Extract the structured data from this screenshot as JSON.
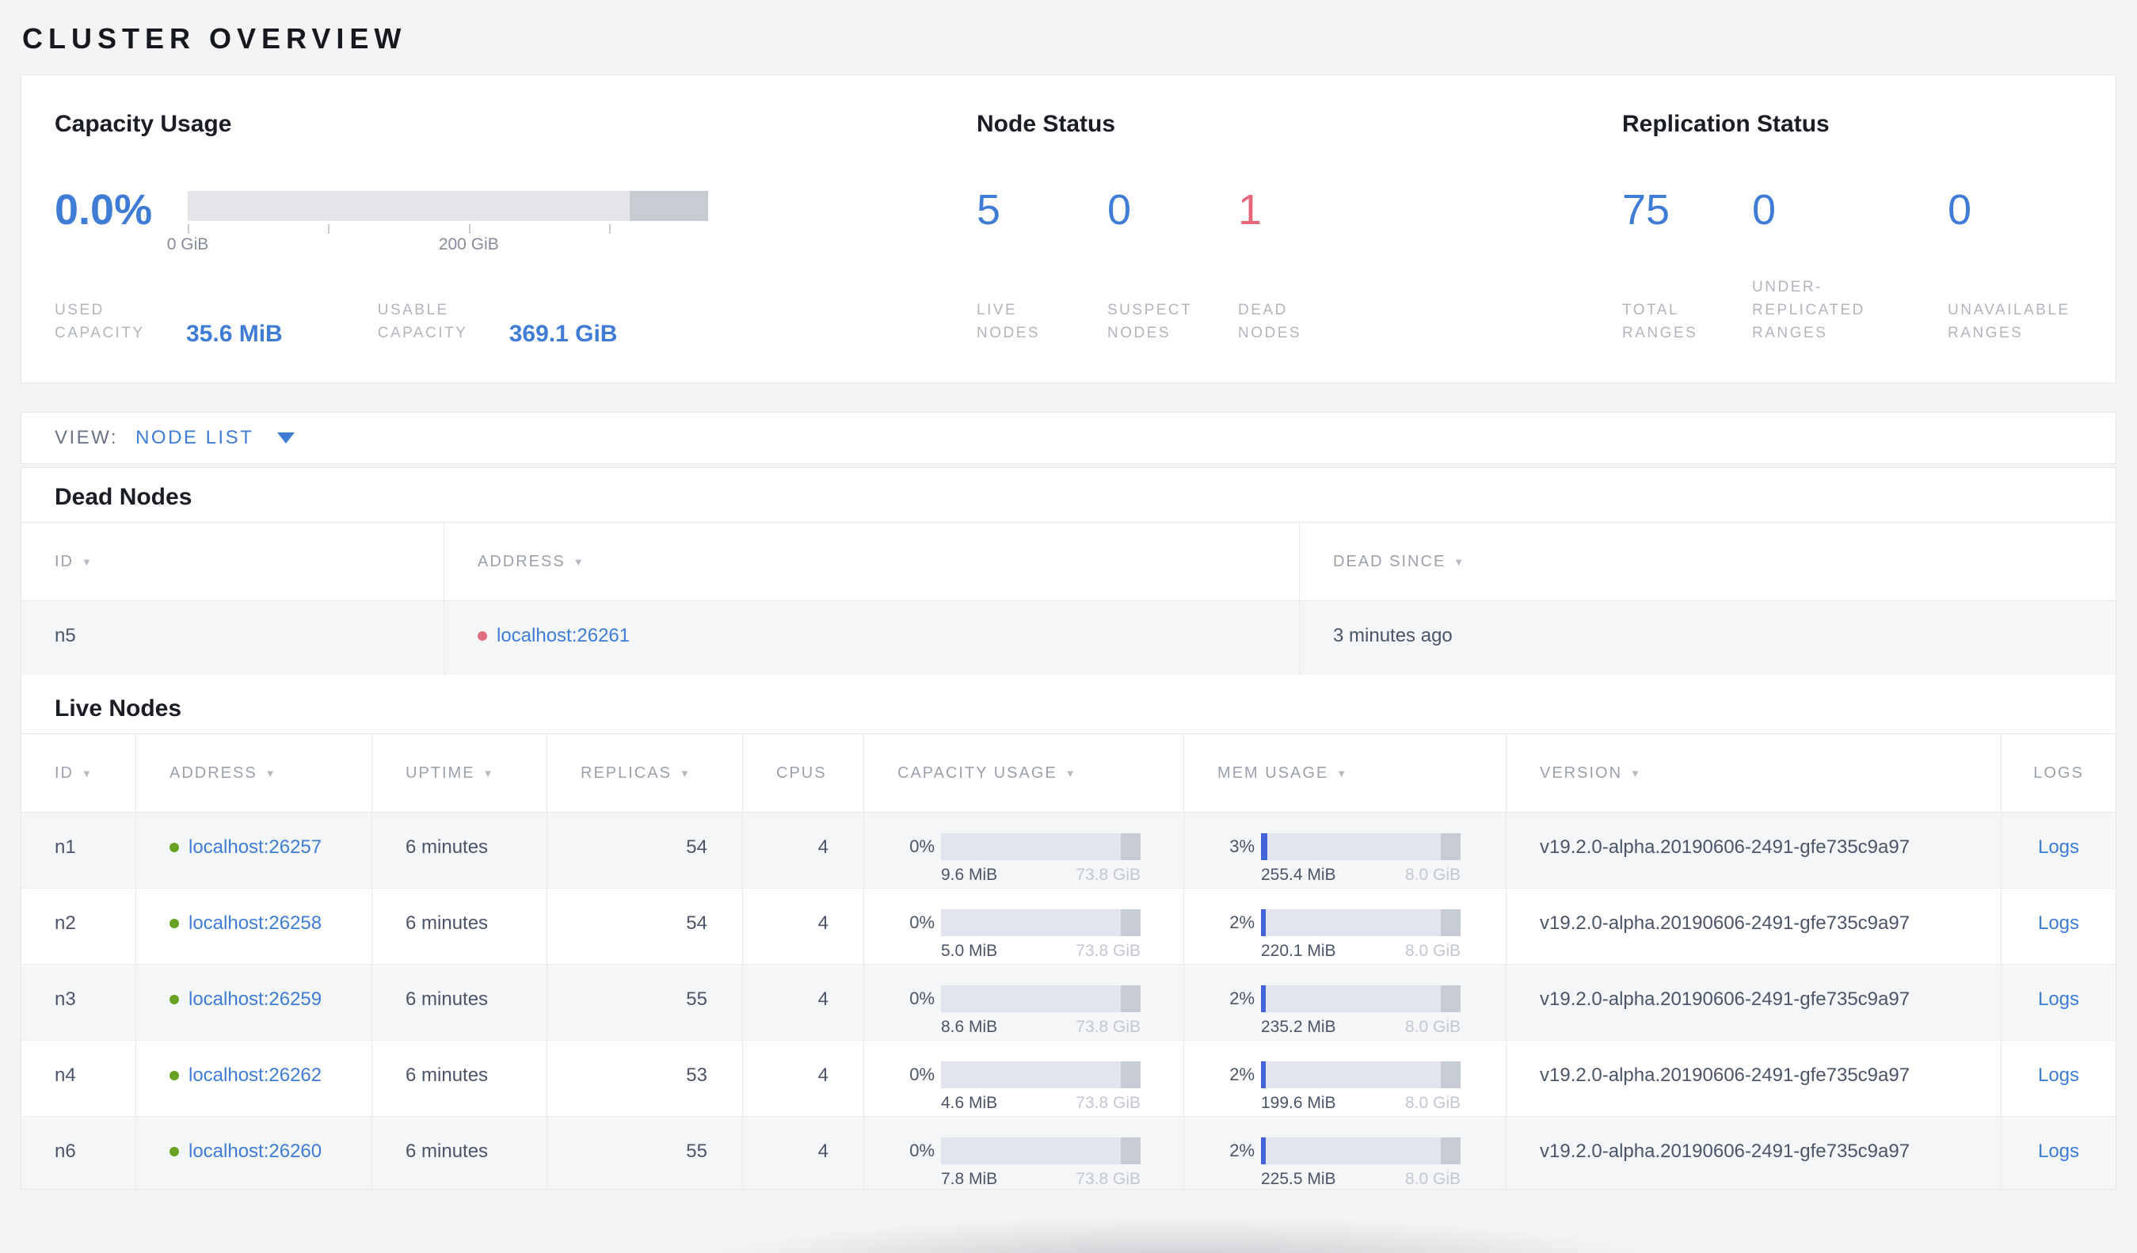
{
  "page": {
    "title": "CLUSTER OVERVIEW"
  },
  "colors": {
    "accent_blue": "#3e7cd6",
    "mem_fill_blue": "#4264d8",
    "dead_red": "#e4677a",
    "live_dot_green": "#66a223",
    "dead_dot_red": "#e06e7e",
    "bar_track": "#e2e5ee",
    "bar_cap": "#c7cbd4"
  },
  "icons": {
    "sort_arrow": "▼",
    "dropdown_arrow": "▼"
  },
  "summary": {
    "capacity": {
      "title": "Capacity Usage",
      "percent": "0.0%",
      "tick_labels": [
        "0 GiB",
        "200 GiB"
      ],
      "stats": [
        {
          "label": "USED\nCAPACITY",
          "value": "35.6 MiB"
        },
        {
          "label": "USABLE\nCAPACITY",
          "value": "369.1 GiB"
        }
      ]
    },
    "node_status": {
      "title": "Node Status",
      "stats": [
        {
          "value": "5",
          "label": "LIVE\nNODES"
        },
        {
          "value": "0",
          "label": "SUSPECT\nNODES"
        },
        {
          "value": "1",
          "label": "DEAD\nNODES"
        }
      ]
    },
    "replication": {
      "title": "Replication Status",
      "stats": [
        {
          "value": "75",
          "label": "TOTAL\nRANGES"
        },
        {
          "value": "0",
          "label": "UNDER-\nREPLICATED\nRANGES"
        },
        {
          "value": "0",
          "label": "UNAVAILABLE\nRANGES"
        }
      ]
    }
  },
  "view_bar": {
    "label": "VIEW:",
    "selected": "NODE LIST"
  },
  "dead_nodes": {
    "title": "Dead Nodes",
    "columns": [
      "ID",
      "ADDRESS",
      "DEAD SINCE"
    ],
    "rows": [
      {
        "id": "n5",
        "address": "localhost:26261",
        "dead_since": "3 minutes ago"
      }
    ]
  },
  "live_nodes": {
    "title": "Live Nodes",
    "columns": [
      "ID",
      "ADDRESS",
      "UPTIME",
      "REPLICAS",
      "CPUS",
      "CAPACITY USAGE",
      "MEM USAGE",
      "VERSION",
      "LOGS"
    ],
    "logs_label": "Logs",
    "rows": [
      {
        "id": "n1",
        "address": "localhost:26257",
        "uptime": "6 minutes",
        "replicas": "54",
        "cpus": "4",
        "capacity": {
          "percent": "0%",
          "fill": "0%",
          "used": "9.6 MiB",
          "total": "73.8 GiB"
        },
        "memory": {
          "percent": "3%",
          "fill": "3%",
          "used": "255.4 MiB",
          "total": "8.0 GiB"
        },
        "version": "v19.2.0-alpha.20190606-2491-gfe735c9a97",
        "logs": "Logs"
      },
      {
        "id": "n2",
        "address": "localhost:26258",
        "uptime": "6 minutes",
        "replicas": "54",
        "cpus": "4",
        "capacity": {
          "percent": "0%",
          "fill": "0%",
          "used": "5.0 MiB",
          "total": "73.8 GiB"
        },
        "memory": {
          "percent": "2%",
          "fill": "2.5%",
          "used": "220.1 MiB",
          "total": "8.0 GiB"
        },
        "version": "v19.2.0-alpha.20190606-2491-gfe735c9a97",
        "logs": "Logs"
      },
      {
        "id": "n3",
        "address": "localhost:26259",
        "uptime": "6 minutes",
        "replicas": "55",
        "cpus": "4",
        "capacity": {
          "percent": "0%",
          "fill": "0%",
          "used": "8.6 MiB",
          "total": "73.8 GiB"
        },
        "memory": {
          "percent": "2%",
          "fill": "2.5%",
          "used": "235.2 MiB",
          "total": "8.0 GiB"
        },
        "version": "v19.2.0-alpha.20190606-2491-gfe735c9a97",
        "logs": "Logs"
      },
      {
        "id": "n4",
        "address": "localhost:26262",
        "uptime": "6 minutes",
        "replicas": "53",
        "cpus": "4",
        "capacity": {
          "percent": "0%",
          "fill": "0%",
          "used": "4.6 MiB",
          "total": "73.8 GiB"
        },
        "memory": {
          "percent": "2%",
          "fill": "2.5%",
          "used": "199.6 MiB",
          "total": "8.0 GiB"
        },
        "version": "v19.2.0-alpha.20190606-2491-gfe735c9a97",
        "logs": "Logs"
      },
      {
        "id": "n6",
        "address": "localhost:26260",
        "uptime": "6 minutes",
        "replicas": "55",
        "cpus": "4",
        "capacity": {
          "percent": "0%",
          "fill": "0%",
          "used": "7.8 MiB",
          "total": "73.8 GiB"
        },
        "memory": {
          "percent": "2%",
          "fill": "2.5%",
          "used": "225.5 MiB",
          "total": "8.0 GiB"
        },
        "version": "v19.2.0-alpha.20190606-2491-gfe735c9a97",
        "logs": "Logs"
      }
    ]
  }
}
